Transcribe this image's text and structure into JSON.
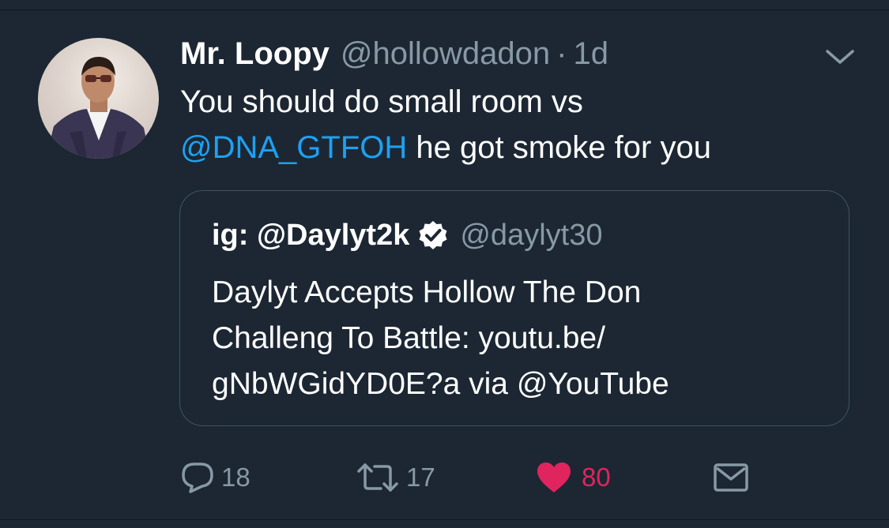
{
  "tweet": {
    "author_name": "Mr. Loopy",
    "author_handle": "@hollowdadon",
    "separator": "·",
    "timestamp": "1d",
    "text_line1": "You should do small room vs",
    "mention": "@DNA_GTFOH",
    "text_line2_rest": " he got smoke for you"
  },
  "quoted_tweet": {
    "author_name": "ig: @Daylyt2k",
    "author_handle": "@daylyt30",
    "verified": true,
    "lines": [
      "Daylyt Accepts Hollow The Don",
      "Challeng To Battle: youtu.be/",
      "gNbWGidYD0E?a via @YouTube"
    ]
  },
  "actions": {
    "reply_count": "18",
    "retweet_count": "17",
    "like_count": "80",
    "liked": true
  },
  "icons": {
    "reply": "reply-icon",
    "retweet": "retweet-icon",
    "like": "heart-icon",
    "dm": "envelope-icon",
    "caret": "chevron-down-icon",
    "verified": "verified-badge-icon"
  },
  "colors": {
    "background": "#1c2733",
    "link": "#1da1f2",
    "muted": "#8899a6",
    "like": "#e0245e"
  }
}
